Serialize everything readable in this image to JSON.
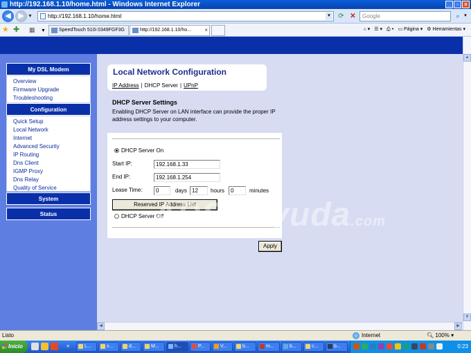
{
  "window": {
    "title": "http://192.168.1.10/home.html - Windows Internet Explorer"
  },
  "addressbar": {
    "url": "http://192.168.1.10/home.html",
    "search_placeholder": "Google"
  },
  "tabs": [
    {
      "label": "SpeedTouch 510i  0349FGF3G"
    },
    {
      "label": "http://192.168.1.10/ho..."
    }
  ],
  "toolbar_right": {
    "page_label": "Página",
    "tools_label": "Herramientas"
  },
  "sidebar": {
    "sections": [
      {
        "title": "My DSL Modem",
        "items": [
          "Overview",
          "Firmware Upgrade",
          "Troubleshooting"
        ]
      },
      {
        "title": "Configuration",
        "items": [
          "Quick Setup",
          "Local Network",
          "Internet",
          "Advanced Security",
          "IP Routing",
          "Dns Client",
          "IGMP Proxy",
          "Dns Relay",
          "Quality of Service"
        ]
      },
      {
        "title": "System",
        "items": []
      },
      {
        "title": "Status",
        "items": []
      }
    ]
  },
  "main": {
    "title": "Local Network Configuration",
    "tabs": [
      "IP Address",
      "DHCP Server",
      "UPnP"
    ],
    "section_title": "DHCP Server Settings",
    "description": "Enabling DHCP Server on LAN interface can provide the proper IP address settings to your computer.",
    "dhcp_on_label": "DHCP Server On",
    "dhcp_on_selected": true,
    "start_ip_label": "Start IP:",
    "start_ip_value": "192.168.1.33",
    "end_ip_label": "End IP:",
    "end_ip_value": "192.168.1.254",
    "lease_label": "Lease Time:",
    "lease_days_value": "0",
    "days_label": "days",
    "lease_hours_value": "12",
    "hours_label": "hours",
    "lease_minutes_value": "0",
    "minutes_label": "minutes",
    "reserved_button": "Reserved IP Address List",
    "dhcp_off_label": "DHCP Server Off",
    "apply_button": "Apply"
  },
  "watermark": {
    "text1": "ADSL",
    "text2": "Ayuda",
    "text3": ".com"
  },
  "statusbar": {
    "status": "Listo",
    "zone": "Internet",
    "zoom": "100%"
  },
  "taskbar": {
    "start_label": "Inicio",
    "tasks": [
      "L...",
      "x...",
      "d...",
      "M...",
      "h...",
      "P...",
      "V...",
      "b...",
      "m...",
      "b...",
      "c...",
      "b..."
    ],
    "clock": "0:23"
  }
}
